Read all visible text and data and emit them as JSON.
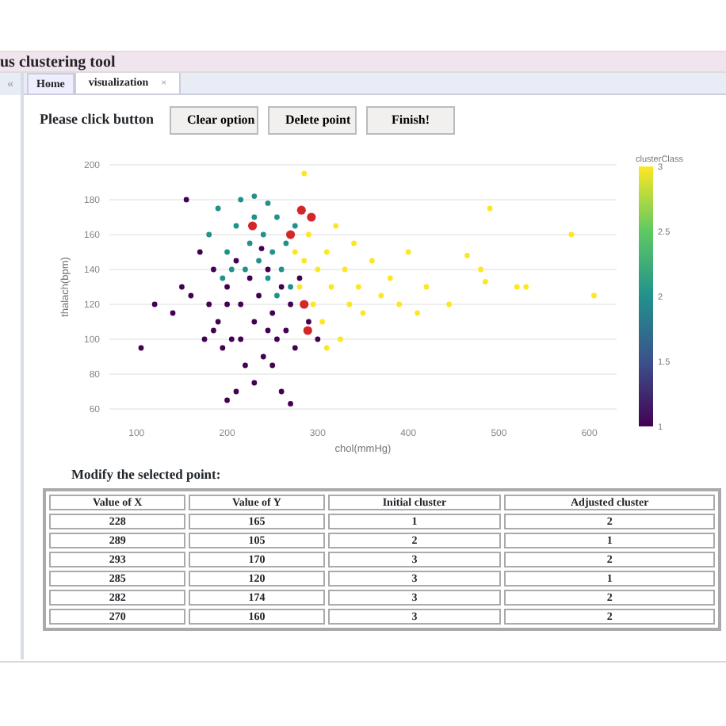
{
  "window": {
    "title": "us clustering tool"
  },
  "sidebar": {
    "collapse_icon": "«"
  },
  "tabs": [
    {
      "label": "Home",
      "selected": false
    },
    {
      "label": "visualization",
      "selected": true,
      "close": "×"
    }
  ],
  "toolbar": {
    "prompt": "Please click button",
    "buttons": [
      "Clear option",
      "Delete  point",
      "Finish!"
    ]
  },
  "chart": {
    "chart_data": {
      "type": "scatter",
      "xlabel": "chol(mmHg)",
      "ylabel": "thalach(bpm)",
      "xlim": [
        70,
        630
      ],
      "ylim": [
        60,
        200
      ],
      "grid": true,
      "xticks": [
        100,
        200,
        300,
        400,
        500,
        600
      ],
      "yticks": [
        60,
        80,
        100,
        120,
        140,
        160,
        180,
        200
      ],
      "series": [
        {
          "color": "#440154",
          "x": [
            150,
            160,
            170,
            180,
            185,
            190,
            195,
            200,
            205,
            210,
            215,
            220,
            225,
            230,
            235,
            240,
            245,
            250,
            255,
            260,
            265,
            270,
            275,
            280,
            290,
            300,
            120,
            105,
            140,
            210,
            230,
            200,
            250,
            260,
            185,
            215,
            245,
            238,
            200,
            175,
            155,
            270
          ],
          "values": [
            130,
            125,
            150,
            120,
            140,
            110,
            95,
            130,
            100,
            145,
            120,
            85,
            135,
            110,
            125,
            90,
            140,
            115,
            100,
            130,
            105,
            120,
            95,
            135,
            110,
            100,
            120,
            95,
            115,
            70,
            75,
            65,
            85,
            70,
            105,
            100,
            105,
            152,
            120,
            100,
            180,
            63
          ]
        },
        {
          "color": "#21918c",
          "x": [
            180,
            190,
            200,
            210,
            215,
            220,
            225,
            230,
            235,
            240,
            245,
            250,
            255,
            260,
            265,
            270,
            275,
            230,
            205,
            255,
            195,
            245
          ],
          "values": [
            160,
            175,
            150,
            165,
            180,
            140,
            155,
            170,
            145,
            160,
            135,
            150,
            170,
            140,
            155,
            130,
            165,
            182,
            140,
            125,
            135,
            178
          ]
        },
        {
          "color": "#fde725",
          "x": [
            275,
            280,
            285,
            290,
            295,
            300,
            305,
            310,
            315,
            320,
            325,
            330,
            335,
            340,
            345,
            350,
            360,
            370,
            380,
            390,
            400,
            410,
            420,
            445,
            465,
            480,
            485,
            490,
            520,
            530,
            580,
            605,
            285,
            310
          ],
          "values": [
            150,
            130,
            145,
            160,
            120,
            140,
            110,
            150,
            130,
            165,
            100,
            140,
            120,
            155,
            130,
            115,
            145,
            125,
            135,
            120,
            150,
            115,
            130,
            120,
            148,
            140,
            133,
            175,
            130,
            130,
            160,
            125,
            195,
            95
          ]
        },
        {
          "color": "#d62728",
          "x": [
            228,
            289,
            293,
            285,
            282,
            270
          ],
          "values": [
            165,
            105,
            170,
            120,
            174,
            160
          ]
        }
      ]
    },
    "colorbar": {
      "title": "clusterClass",
      "ticks": [
        "3",
        "2.5",
        "2",
        "1.5",
        "1"
      ]
    }
  },
  "table": {
    "caption": "Modify the selected point:",
    "columns": [
      "Value of  X",
      "Value of  Y",
      "Initial cluster",
      "Adjusted cluster"
    ],
    "rows": [
      [
        "228",
        "165",
        "1",
        "2"
      ],
      [
        "289",
        "105",
        "2",
        "1"
      ],
      [
        "293",
        "170",
        "3",
        "2"
      ],
      [
        "285",
        "120",
        "3",
        "1"
      ],
      [
        "282",
        "174",
        "3",
        "2"
      ],
      [
        "270",
        "160",
        "3",
        "2"
      ]
    ]
  }
}
